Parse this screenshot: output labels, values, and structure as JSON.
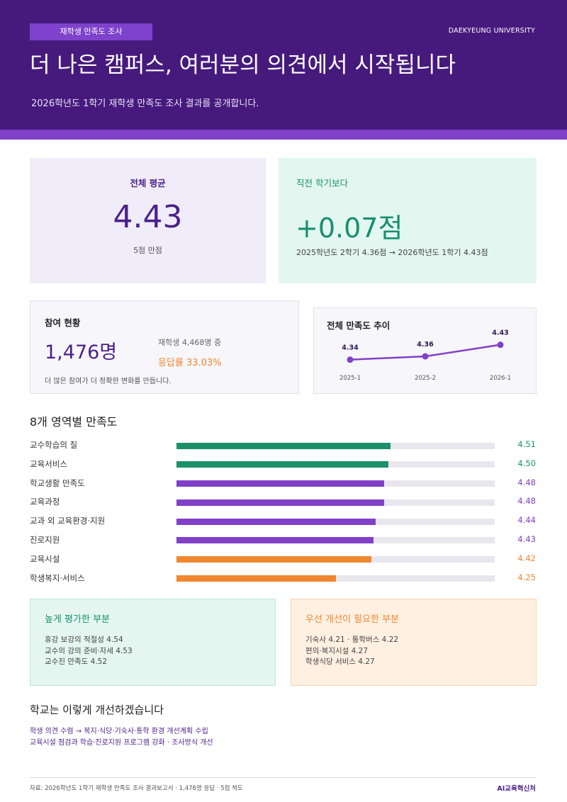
{
  "header": {
    "tag": "재학생 만족도 조사",
    "university": "DAEKYEUNG UNIVERSITY",
    "headline": "더 나은 캠퍼스, 여러분의 의견에서 시작됩니다",
    "subline": "2026학년도 1학기 재학생 만족도 조사 결과를 공개합니다."
  },
  "overall": {
    "label": "전체 평균",
    "value": "4.43",
    "note": "5점 만점"
  },
  "change": {
    "label": "직전 학기보다",
    "value": "+0.07점",
    "note": "2025학년도 2학기 4.36점 → 2026학년도 1학기 4.43점"
  },
  "participation": {
    "title": "참여 현황",
    "count": "1,476명",
    "students": "재학생 4,468명 중",
    "rate": "응답률 33.03%",
    "note": "더 많은 참여가 더 정확한 변화를 만듭니다."
  },
  "trend": {
    "title": "전체 만족도 추이"
  },
  "areas": {
    "title": "8개 영역별 만족도"
  },
  "colors": {
    "high": "#1c9068",
    "mid": "#8140c8",
    "low": "#f0872f"
  },
  "chart_data": [
    {
      "type": "line",
      "title": "전체 만족도 추이",
      "x": [
        "2025-1",
        "2025-2",
        "2026-1"
      ],
      "series": [
        {
          "values": [
            4.34,
            4.36,
            4.43
          ]
        }
      ]
    },
    {
      "type": "bar",
      "orientation": "horizontal",
      "title": "8개 영역별 만족도",
      "categories": [
        "교수학습의 질",
        "교육서비스",
        "학교생활 만족도",
        "교육과정",
        "교과 외 교육환경·지원",
        "진로지원",
        "교육시설",
        "학생복지·서비스"
      ],
      "values": [
        4.51,
        4.5,
        4.48,
        4.48,
        4.44,
        4.43,
        4.42,
        4.25
      ],
      "labels": [
        "4.51",
        "4.50",
        "4.48",
        "4.48",
        "4.44",
        "4.43",
        "4.42",
        "4.25"
      ],
      "tiers": [
        "high",
        "high",
        "mid",
        "mid",
        "mid",
        "mid",
        "low",
        "low"
      ],
      "xlim": [
        3.5,
        5.0
      ]
    }
  ],
  "strengths": {
    "title": "높게 평가한 부분",
    "items": [
      "휴강 보강의 적절성  4.54",
      "교수의 강의 준비·자세  4.53",
      "교수진 만족도  4.52"
    ]
  },
  "improvements": {
    "title": "우선 개선이 필요한 부분",
    "items": [
      "기숙사  4.21  ·  통학버스  4.22",
      "편의·복지시설  4.27",
      "학생식당 서비스  4.27"
    ]
  },
  "plan": {
    "title": "학교는 이렇게 개선하겠습니다",
    "line1": "학생 의견 수렴 → 복지·식당·기숙사·통학 환경 개선계획 수립",
    "line2": "교육시설 점검과 학습·진로지원 프로그램 강화 · 조사방식 개선"
  },
  "footer": {
    "source": "자료: 2026학년도 1학기 재학생 만족도 조사 결과보고서 · 1,476명 응답 · 5점 척도",
    "org": "AI교육혁신처"
  }
}
